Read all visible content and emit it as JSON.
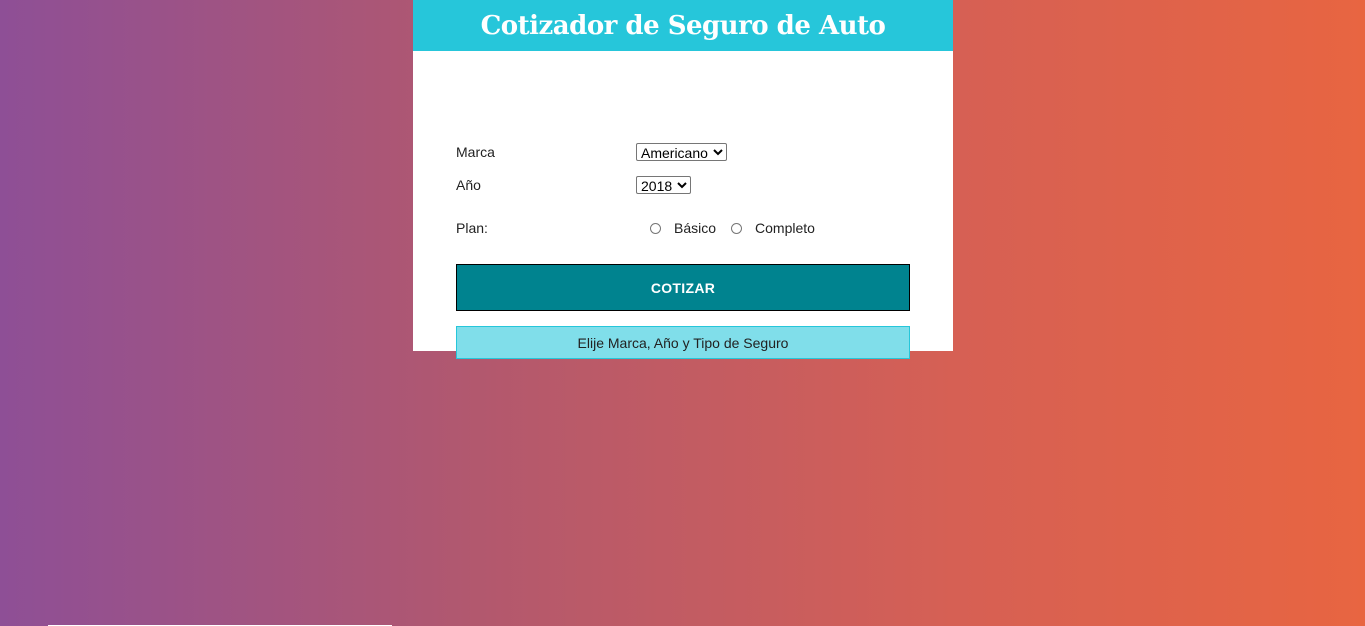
{
  "header": {
    "title": "Cotizador de Seguro de Auto"
  },
  "form": {
    "marca": {
      "label": "Marca",
      "selected": "Americano",
      "options": [
        "Americano"
      ]
    },
    "anio": {
      "label": "Año",
      "selected": "2018",
      "options": [
        "2018"
      ]
    },
    "plan": {
      "label": "Plan:",
      "options": [
        {
          "label": "Básico",
          "checked": false
        },
        {
          "label": "Completo",
          "checked": false
        }
      ]
    },
    "submit_label": "COTIZAR"
  },
  "message": "Elije Marca, Año y Tipo de Seguro",
  "colors": {
    "header_bg": "#26c6da",
    "button_bg": "#00838f",
    "message_bg": "#80deea",
    "gradient_start": "#8e4f96",
    "gradient_end": "#e86541"
  }
}
